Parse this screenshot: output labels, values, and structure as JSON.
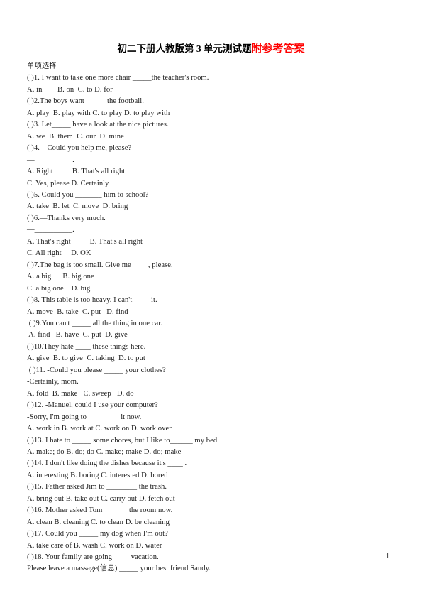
{
  "document": {
    "title": {
      "main": "初二下册人教版第 3 单元测试题",
      "accent": "附参考答案",
      "accent_color": "#FF0000"
    },
    "page_number": "1",
    "section_heading": "单项选择",
    "lines": [
      "单项选择",
      "( )1. I want to take one more chair _____the teacher's room.",
      "A. in        B. on  C. to D. for",
      "( )2.The boys want _____ the football.",
      "A. play  B. play with C. to play D. to play with",
      "( )3. Let_____ have a look at the nice pictures.",
      "A. we  B. them  C. our  D. mine",
      "( )4.—Could you help me, please?",
      "—__________.",
      "A. Right          B. That's all right",
      "C. Yes, please D. Certainly",
      "( )5. Could you _______ him to school?",
      "A. take  B. let  C. move  D. bring",
      "( )6.—Thanks very much.",
      "—__________.",
      "A. That's right          B. That's all right",
      "C. All right     D. OK",
      "( )7.The bag is too small. Give me ____, please.",
      "A. a big      B. big one",
      "C. a big one    D. big",
      "( )8. This table is too heavy. I can't ____ it.",
      "A. move  B. take  C. put   D. find",
      " ( )9.You can't _____ all the thing in one car.",
      " A. find   B. have  C. put  D. give",
      "( )10.They hate ____ these things here.",
      "A. give  B. to give  C. taking  D. to put",
      " ( )11. -Could you please _____ your clothes?",
      "-Certainly, mom.",
      "A. fold  B. make   C. sweep   D. do",
      "( )12. -Manuel, could I use your computer?",
      "-Sorry, I'm going to ________ it now.",
      "A. work in B. work at C. work on D. work over",
      "( )13. I hate to _____ some chores, but I like to______ my bed.",
      "A. make; do B. do; do C. make; make D. do; make",
      "( )14. I don't like doing the dishes because it's ____ .",
      "A. interesting B. boring C. interested D. bored",
      "( )15. Father asked Jim to ________ the trash.",
      "A. bring out B. take out C. carry out D. fetch out",
      "( )16. Mother asked Tom ______ the room now.",
      "A. clean B. cleaning C. to clean D. be cleaning",
      "( )17. Could you _____ my dog when I'm out?",
      "A. take care of B. wash C. work on D. water",
      "( )18. Your family are going ____ vacation.",
      "Please leave a massage(信息) _____ your best friend Sandy."
    ]
  }
}
